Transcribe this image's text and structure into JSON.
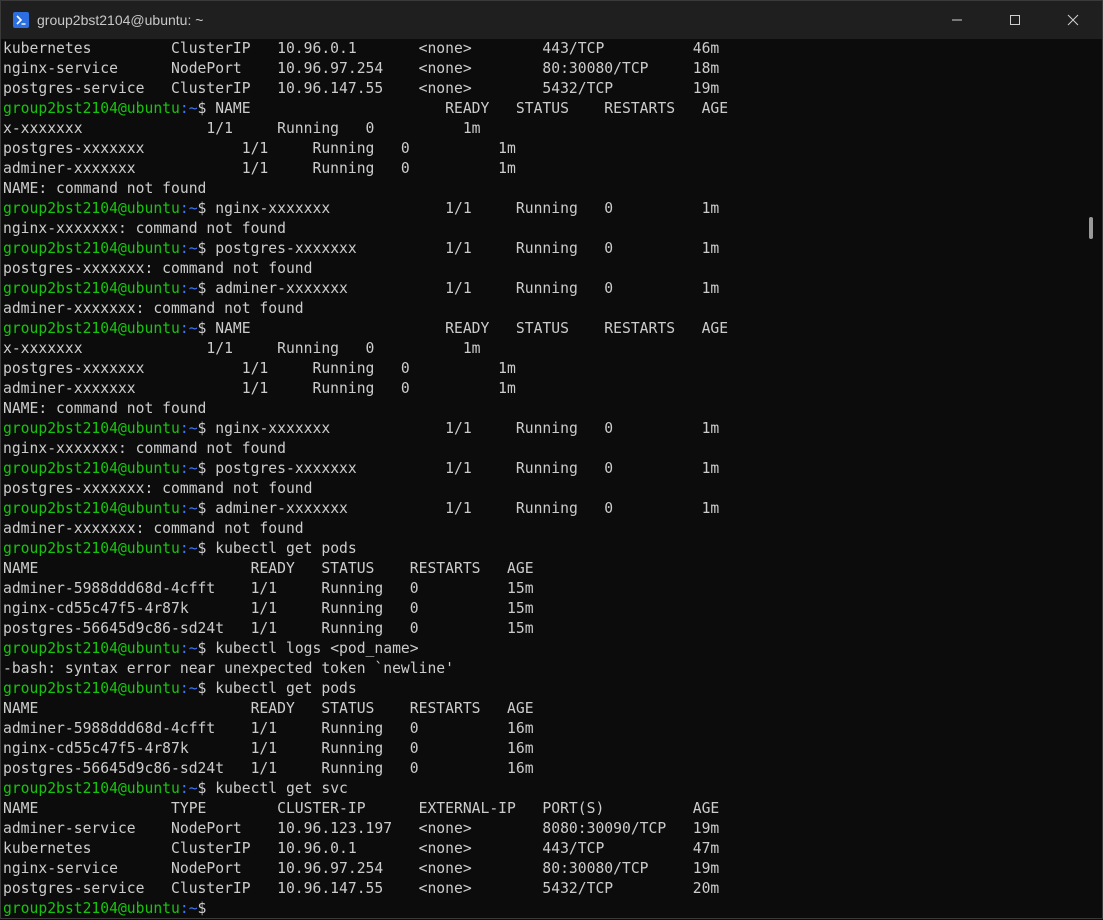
{
  "window": {
    "title": "group2bst2104@ubuntu: ~",
    "app_icon": "powershell-icon",
    "controls": [
      "minimize-icon",
      "maximize-icon",
      "close-icon"
    ]
  },
  "prompt": {
    "user_host": "group2bst2104@ubuntu",
    "path": ":~",
    "symbol": "$ "
  },
  "lines": [
    {
      "type": "out",
      "text": "kubernetes         ClusterIP   10.96.0.1       <none>        443/TCP          46m"
    },
    {
      "type": "out",
      "text": "nginx-service      NodePort    10.96.97.254    <none>        80:30080/TCP     18m"
    },
    {
      "type": "out",
      "text": "postgres-service   ClusterIP   10.96.147.55    <none>        5432/TCP         19m"
    },
    {
      "type": "cmd",
      "text": "NAME                      READY   STATUS    RESTARTS   AGE"
    },
    {
      "type": "out",
      "text": "x-xxxxxxx              1/1     Running   0          1m"
    },
    {
      "type": "out",
      "text": "postgres-xxxxxxx           1/1     Running   0          1m"
    },
    {
      "type": "out",
      "text": "adminer-xxxxxxx            1/1     Running   0          1m"
    },
    {
      "type": "out",
      "text": "NAME: command not found"
    },
    {
      "type": "cmd",
      "text": "nginx-xxxxxxx             1/1     Running   0          1m"
    },
    {
      "type": "out",
      "text": "nginx-xxxxxxx: command not found"
    },
    {
      "type": "cmd",
      "text": "postgres-xxxxxxx          1/1     Running   0          1m"
    },
    {
      "type": "out",
      "text": "postgres-xxxxxxx: command not found"
    },
    {
      "type": "cmd",
      "text": "adminer-xxxxxxx           1/1     Running   0          1m"
    },
    {
      "type": "out",
      "text": "adminer-xxxxxxx: command not found"
    },
    {
      "type": "cmd",
      "text": "NAME                      READY   STATUS    RESTARTS   AGE"
    },
    {
      "type": "out",
      "text": "x-xxxxxxx              1/1     Running   0          1m"
    },
    {
      "type": "out",
      "text": "postgres-xxxxxxx           1/1     Running   0          1m"
    },
    {
      "type": "out",
      "text": "adminer-xxxxxxx            1/1     Running   0          1m"
    },
    {
      "type": "out",
      "text": "NAME: command not found"
    },
    {
      "type": "cmd",
      "text": "nginx-xxxxxxx             1/1     Running   0          1m"
    },
    {
      "type": "out",
      "text": "nginx-xxxxxxx: command not found"
    },
    {
      "type": "cmd",
      "text": "postgres-xxxxxxx          1/1     Running   0          1m"
    },
    {
      "type": "out",
      "text": "postgres-xxxxxxx: command not found"
    },
    {
      "type": "cmd",
      "text": "adminer-xxxxxxx           1/1     Running   0          1m"
    },
    {
      "type": "out",
      "text": "adminer-xxxxxxx: command not found"
    },
    {
      "type": "cmd",
      "text": "kubectl get pods"
    },
    {
      "type": "out",
      "text": "NAME                        READY   STATUS    RESTARTS   AGE"
    },
    {
      "type": "out",
      "text": "adminer-5988ddd68d-4cfft    1/1     Running   0          15m"
    },
    {
      "type": "out",
      "text": "nginx-cd55c47f5-4r87k       1/1     Running   0          15m"
    },
    {
      "type": "out",
      "text": "postgres-56645d9c86-sd24t   1/1     Running   0          15m"
    },
    {
      "type": "cmd",
      "text": "kubectl logs <pod_name>"
    },
    {
      "type": "out",
      "text": "-bash: syntax error near unexpected token `newline'"
    },
    {
      "type": "cmd",
      "text": "kubectl get pods"
    },
    {
      "type": "out",
      "text": "NAME                        READY   STATUS    RESTARTS   AGE"
    },
    {
      "type": "out",
      "text": "adminer-5988ddd68d-4cfft    1/1     Running   0          16m"
    },
    {
      "type": "out",
      "text": "nginx-cd55c47f5-4r87k       1/1     Running   0          16m"
    },
    {
      "type": "out",
      "text": "postgres-56645d9c86-sd24t   1/1     Running   0          16m"
    },
    {
      "type": "cmd",
      "text": "kubectl get svc"
    },
    {
      "type": "out",
      "text": "NAME               TYPE        CLUSTER-IP      EXTERNAL-IP   PORT(S)          AGE"
    },
    {
      "type": "out",
      "text": "adminer-service    NodePort    10.96.123.197   <none>        8080:30090/TCP   19m"
    },
    {
      "type": "out",
      "text": "kubernetes         ClusterIP   10.96.0.1       <none>        443/TCP          47m"
    },
    {
      "type": "out",
      "text": "nginx-service      NodePort    10.96.97.254    <none>        80:30080/TCP     19m"
    },
    {
      "type": "out",
      "text": "postgres-service   ClusterIP   10.96.147.55    <none>        5432/TCP         20m"
    },
    {
      "type": "cmd",
      "text": ""
    }
  ],
  "colors": {
    "background": "#0c0c0c",
    "foreground": "#cccccc",
    "prompt_user": "#16c60c",
    "prompt_path": "#3b78ff",
    "titlebar": "#1f1f1f"
  }
}
